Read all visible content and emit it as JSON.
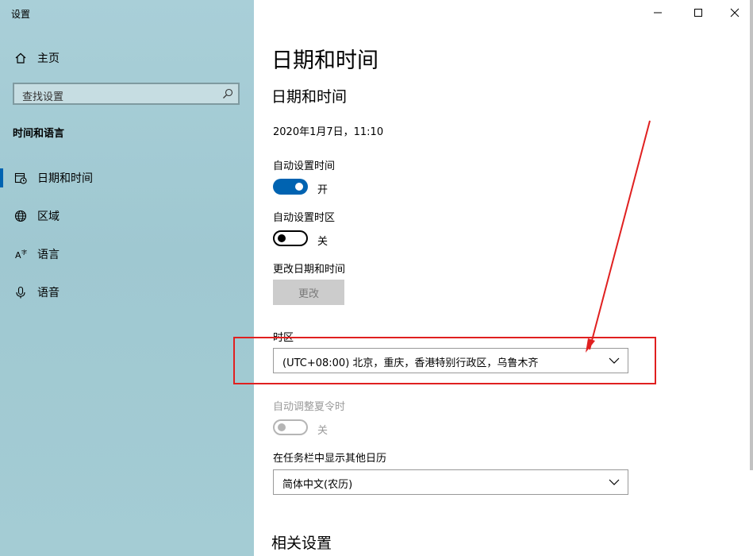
{
  "window": {
    "title": "设置"
  },
  "sidebar": {
    "home_label": "主页",
    "search_placeholder": "查找设置",
    "group_title": "时间和语言",
    "items": [
      {
        "label": "日期和时间",
        "icon": "calendar-clock-icon",
        "active": true
      },
      {
        "label": "区域",
        "icon": "globe-icon"
      },
      {
        "label": "语言",
        "icon": "language-icon"
      },
      {
        "label": "语音",
        "icon": "microphone-icon"
      }
    ]
  },
  "main": {
    "page_title": "日期和时间",
    "section_title": "日期和时间",
    "current_datetime": "2020年1月7日，11:10",
    "auto_time": {
      "label": "自动设置时间",
      "state": "开",
      "on": true
    },
    "auto_timezone": {
      "label": "自动设置时区",
      "state": "关",
      "on": false
    },
    "change_datetime": {
      "label": "更改日期和时间",
      "button": "更改"
    },
    "timezone": {
      "label": "时区",
      "value": "(UTC+08:00) 北京，重庆，香港特别行政区，乌鲁木齐"
    },
    "dst": {
      "label": "自动调整夏令时",
      "state": "关",
      "on": false,
      "disabled": true
    },
    "calendar": {
      "label": "在任务栏中显示其他日历",
      "value": "简体中文(农历)"
    },
    "related_title": "相关设置"
  },
  "colors": {
    "accent": "#0063b1",
    "highlight": "#e02020"
  }
}
